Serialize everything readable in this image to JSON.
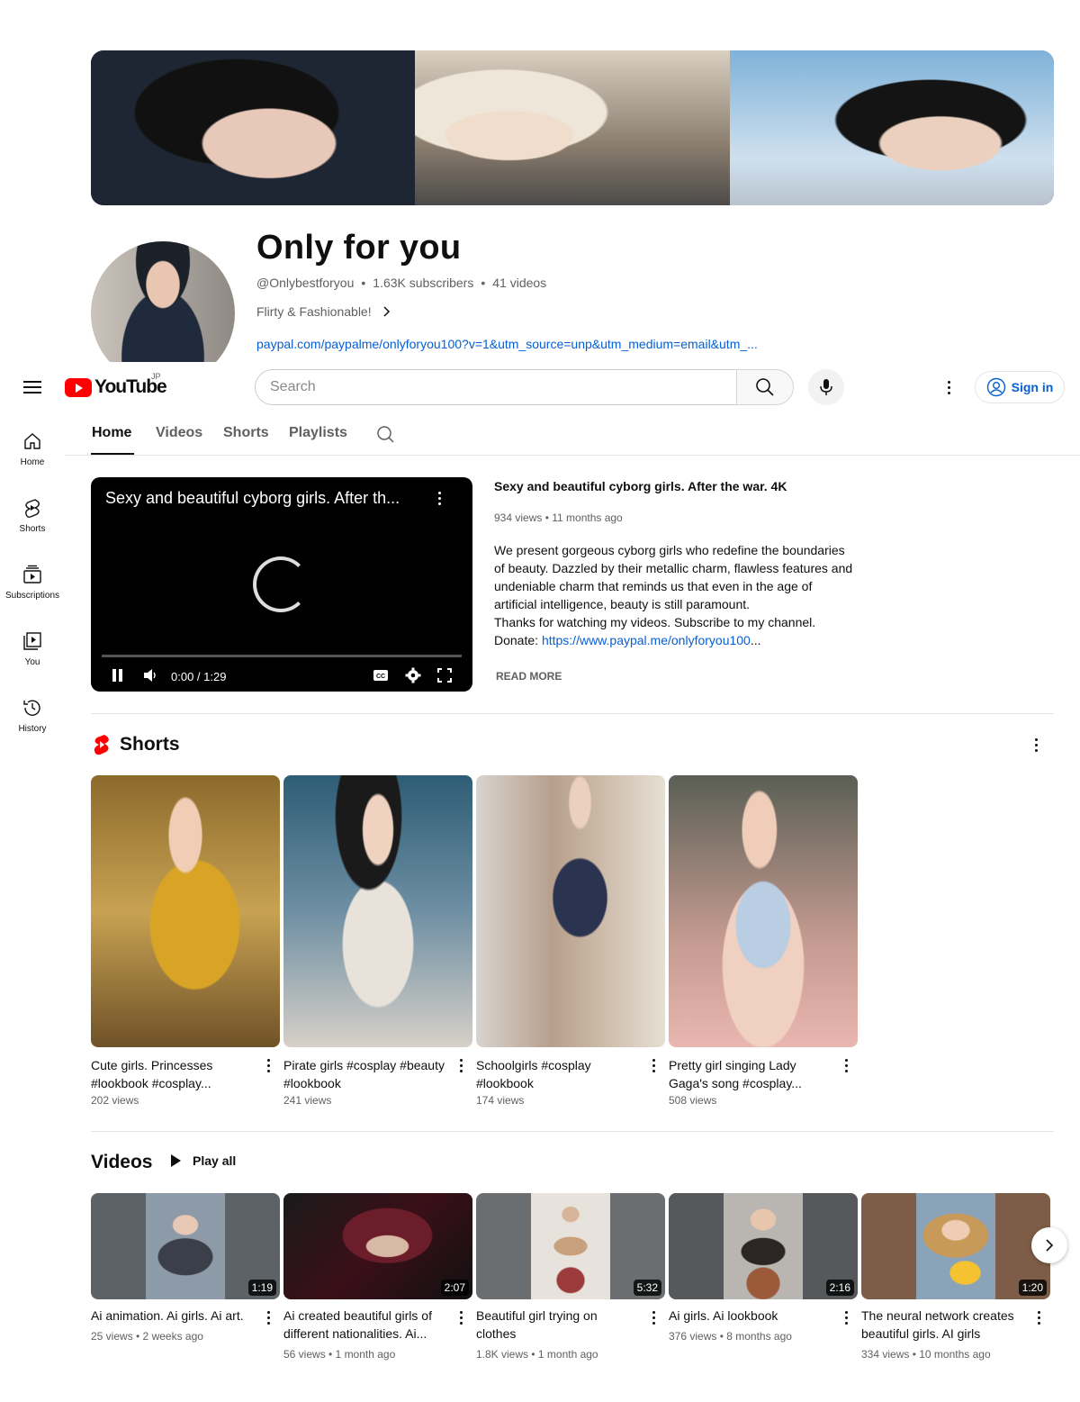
{
  "channel": {
    "name": "Only for you",
    "handle": "@Onlybestforyou",
    "subscribers": "1.63K subscribers",
    "videos_count": "41 videos",
    "description": "Flirty & Fashionable!",
    "link": "paypal.com/paypalme/onlyforyou100?v=1&utm_source=unp&utm_medium=email&utm_..."
  },
  "masthead": {
    "logo_text": "YouTube",
    "region": "JP",
    "search_placeholder": "Search",
    "sign_in": "Sign in"
  },
  "guide": [
    {
      "label": "Home",
      "icon": "home-icon"
    },
    {
      "label": "Shorts",
      "icon": "shorts-icon"
    },
    {
      "label": "Subscriptions",
      "icon": "subscriptions-icon"
    },
    {
      "label": "You",
      "icon": "library-icon"
    },
    {
      "label": "History",
      "icon": "history-icon"
    }
  ],
  "tabs": [
    "Home",
    "Videos",
    "Shorts",
    "Playlists"
  ],
  "featured": {
    "player_title": "Sexy and beautiful cyborg girls. After th...",
    "time": "0:00 / 1:29",
    "title": "Sexy and beautiful cyborg girls. After the war. 4K",
    "meta": "934 views • 11 months ago",
    "desc1": "We present gorgeous cyborg girls who redefine the boundaries of beauty. Dazzled by their metallic charm, flawless features and undeniable charm that reminds us that even in the age of artificial intelligence, beauty is still paramount.",
    "desc2": "Thanks for watching my videos. Subscribe to my channel.",
    "donate_label": "Donate: ",
    "donate_link": "https://www.paypal.me/onlyforyou100",
    "ellipsis": "...",
    "read_more": "READ MORE"
  },
  "shorts": {
    "title": "Shorts",
    "items": [
      {
        "title": "Cute girls. Princesses #lookbook #cosplay...",
        "views": "202 views"
      },
      {
        "title": "Pirate girls #cosplay #beauty #lookbook",
        "views": "241 views"
      },
      {
        "title": "Schoolgirls #cosplay #lookbook",
        "views": "174 views"
      },
      {
        "title": "Pretty girl singing Lady Gaga's song #cosplay...",
        "views": "508 views"
      }
    ]
  },
  "videos": {
    "title": "Videos",
    "play_all": "Play all",
    "items": [
      {
        "title": "Ai animation. Ai girls. Ai art.",
        "duration": "1:19",
        "meta": "25 views • 2 weeks ago"
      },
      {
        "title": "Ai created beautiful girls of different nationalities. Ai...",
        "duration": "2:07",
        "meta": "56 views • 1 month ago"
      },
      {
        "title": "Beautiful girl trying on clothes",
        "duration": "5:32",
        "meta": "1.8K views • 1 month ago"
      },
      {
        "title": "Ai girls. Ai lookbook",
        "duration": "2:16",
        "meta": "376 views • 8 months ago"
      },
      {
        "title": "The neural network creates beautiful girls. AI girls",
        "duration": "1:20",
        "meta": "334 views • 10 months ago"
      }
    ]
  },
  "colors": {
    "brand_red": "#ff0000",
    "link_blue": "#065fd4",
    "text_secondary": "#606060"
  }
}
